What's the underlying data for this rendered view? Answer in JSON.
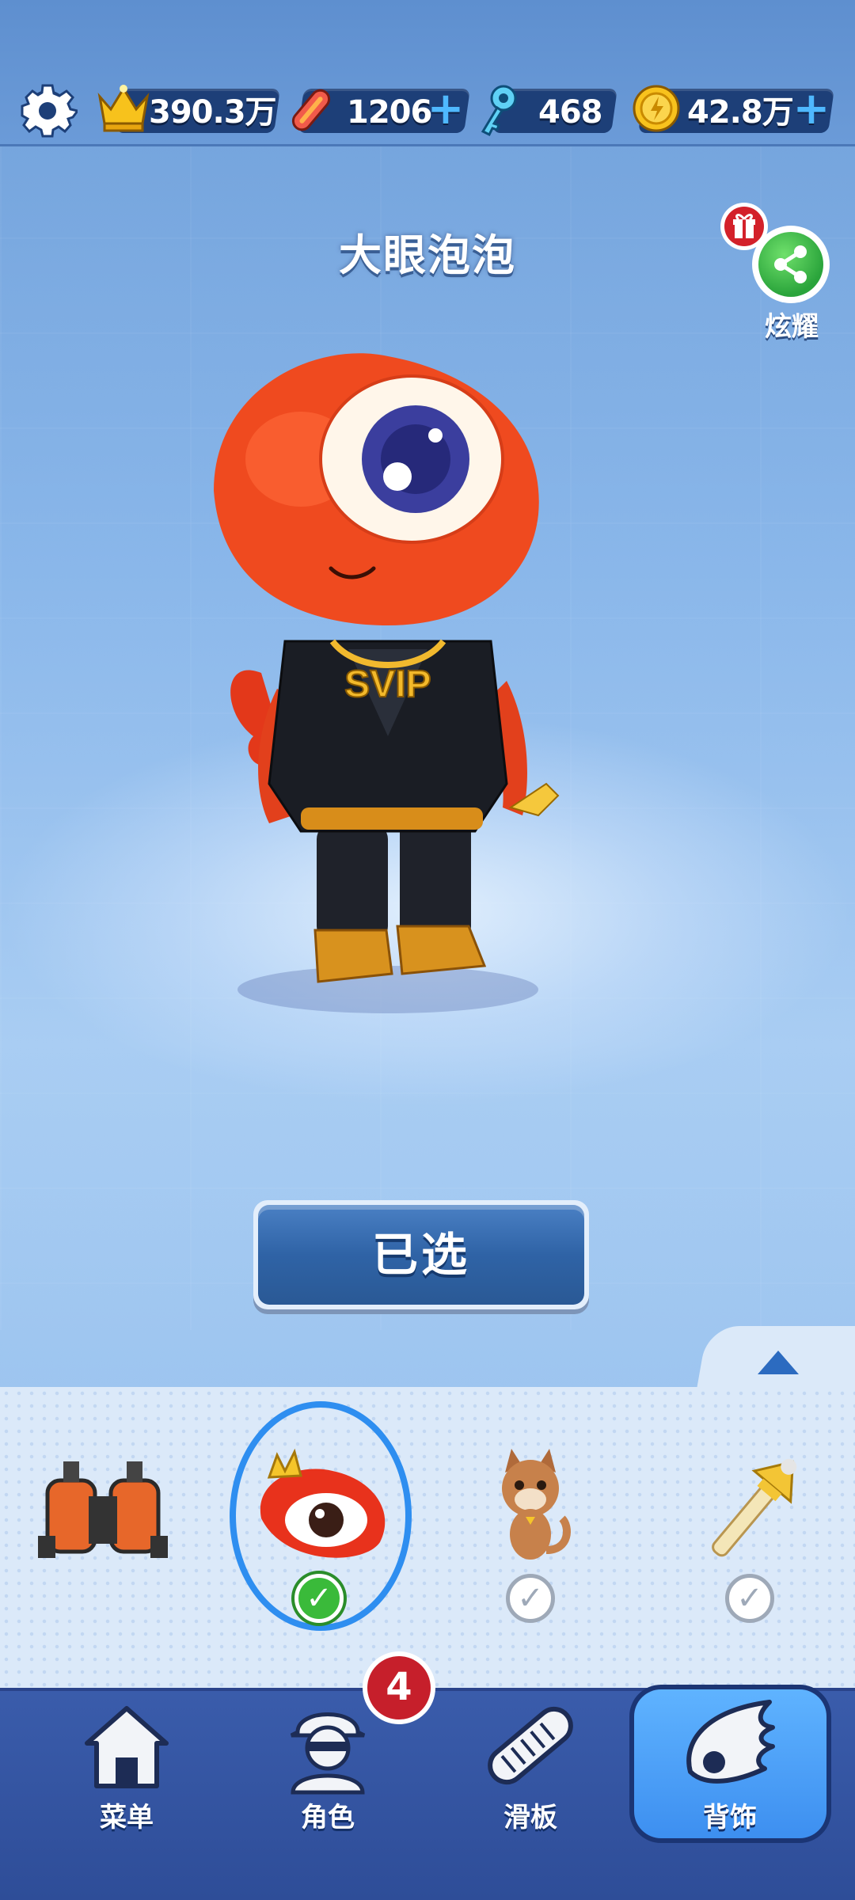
{
  "top_bar": {
    "trophies": "390.3万",
    "boards": "1206",
    "keys": "468",
    "coins": "42.8万"
  },
  "character": {
    "name": "大眼泡泡"
  },
  "share": {
    "label": "炫耀"
  },
  "action": {
    "selected_label": "已选"
  },
  "tray": {
    "items": [
      {
        "icon": "jetpack-icon",
        "checked": false,
        "visible_check": false
      },
      {
        "icon": "weibo-eye-pet-icon",
        "checked": true
      },
      {
        "icon": "cat-pet-icon",
        "checked": false
      },
      {
        "icon": "golden-scepter-icon",
        "checked": false
      }
    ]
  },
  "nav": {
    "menu_label": "菜单",
    "role_label": "角色",
    "role_badge": "4",
    "board_label": "滑板",
    "accessory_label": "背饰"
  }
}
